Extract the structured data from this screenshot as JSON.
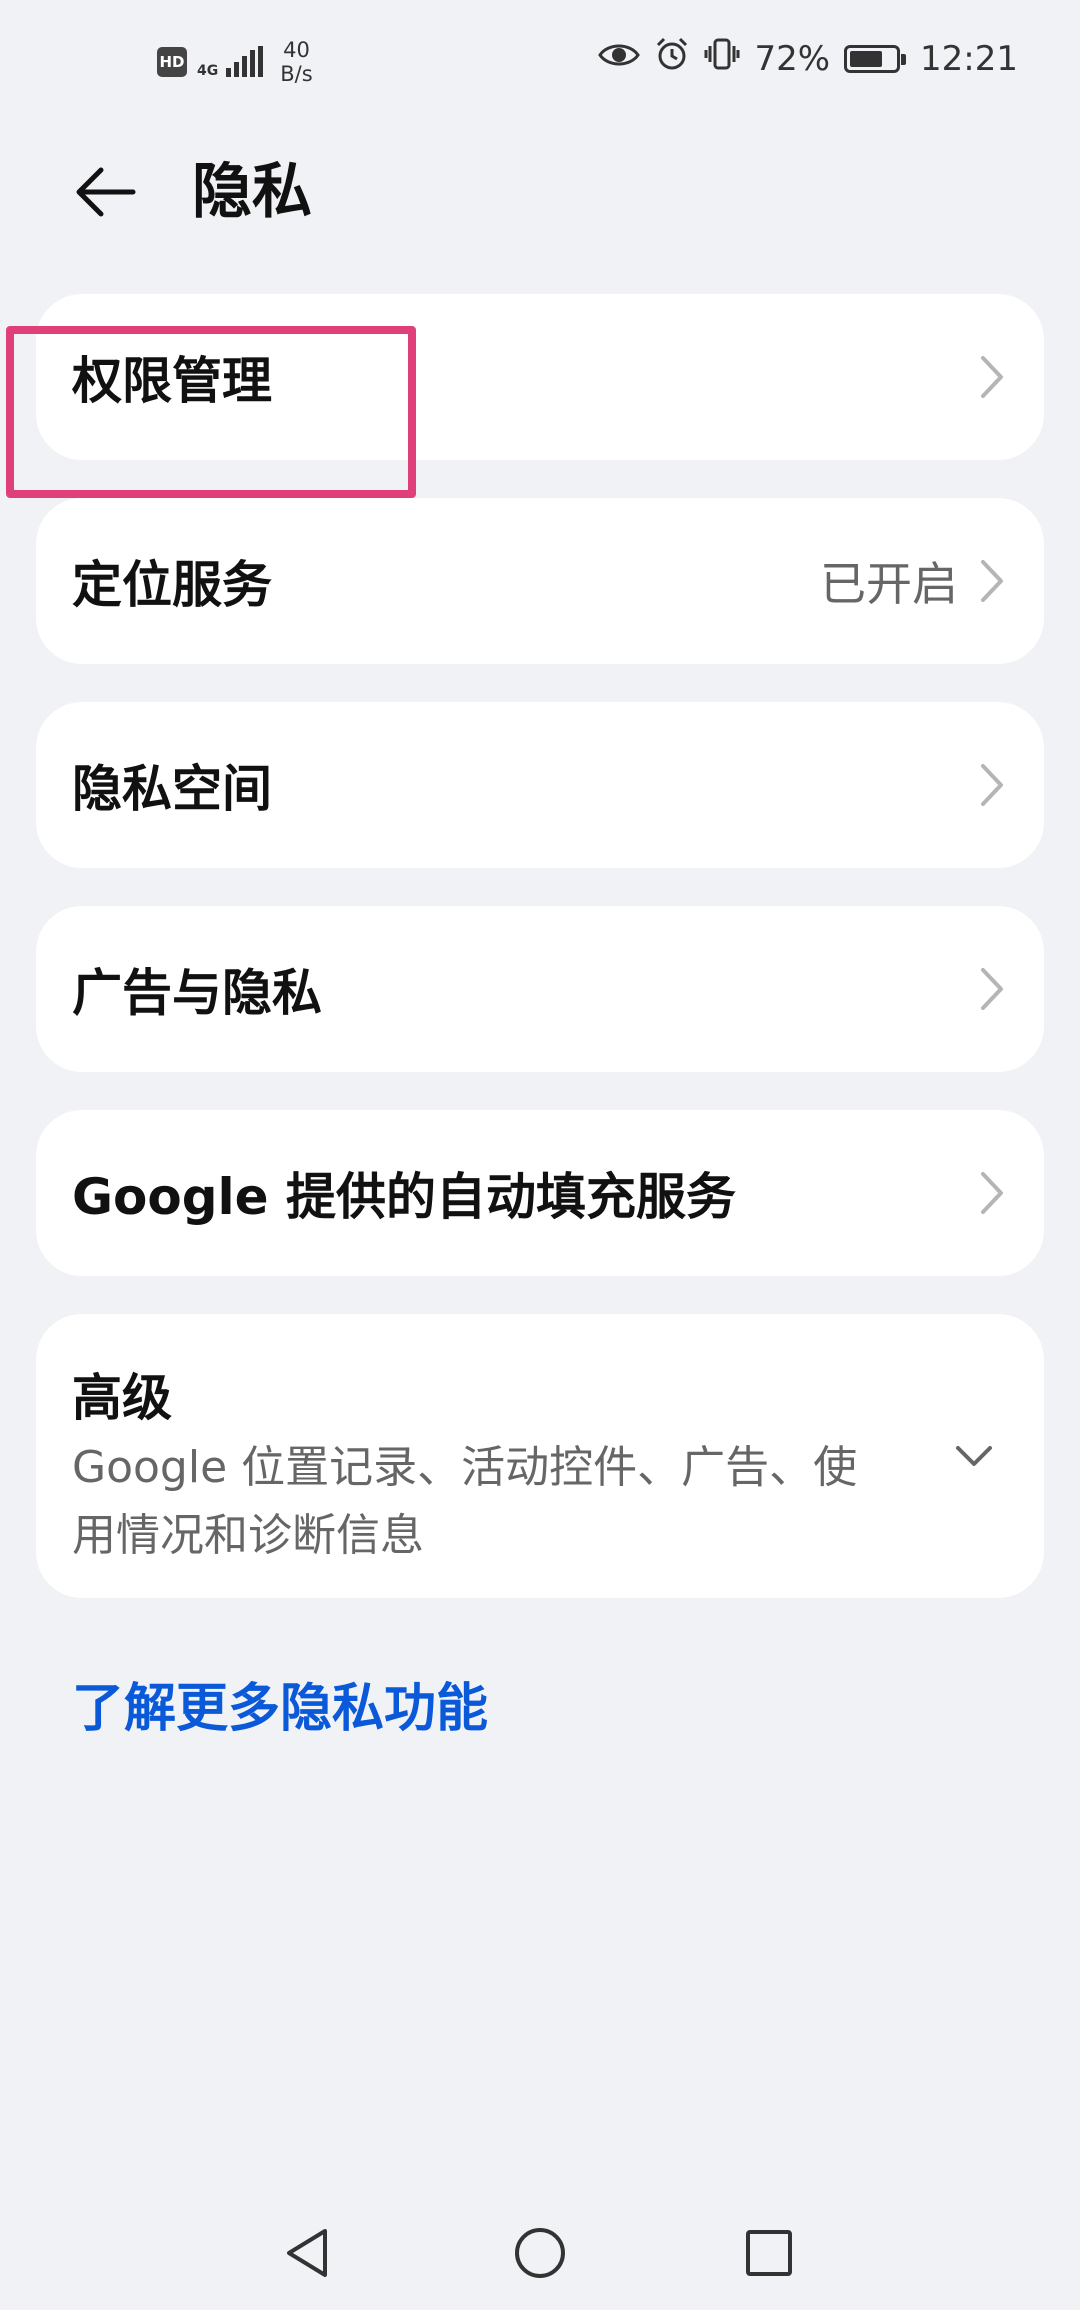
{
  "status_bar": {
    "hd": "HD",
    "network": "4G",
    "speed_value": "40",
    "speed_unit": "B/s",
    "battery_percent": "72%",
    "battery_level": 0.72,
    "time": "12:21",
    "icons": [
      "eye-icon",
      "alarm-icon",
      "vibrate-icon",
      "battery-icon"
    ]
  },
  "header": {
    "title": "隐私"
  },
  "items": [
    {
      "label": "权限管理",
      "value": ""
    },
    {
      "label": "定位服务",
      "value": "已开启"
    },
    {
      "label": "隐私空间",
      "value": ""
    },
    {
      "label": "广告与隐私",
      "value": ""
    },
    {
      "label": "Google 提供的自动填充服务",
      "value": ""
    }
  ],
  "advanced": {
    "title": "高级",
    "description": "Google 位置记录、活动控件、广告、使用情况和诊断信息"
  },
  "learn_more": "了解更多隐私功能",
  "colors": {
    "background": "#f1f2f5",
    "card": "#ffffff",
    "link": "#0a59d8",
    "highlight": "#e0407a"
  }
}
